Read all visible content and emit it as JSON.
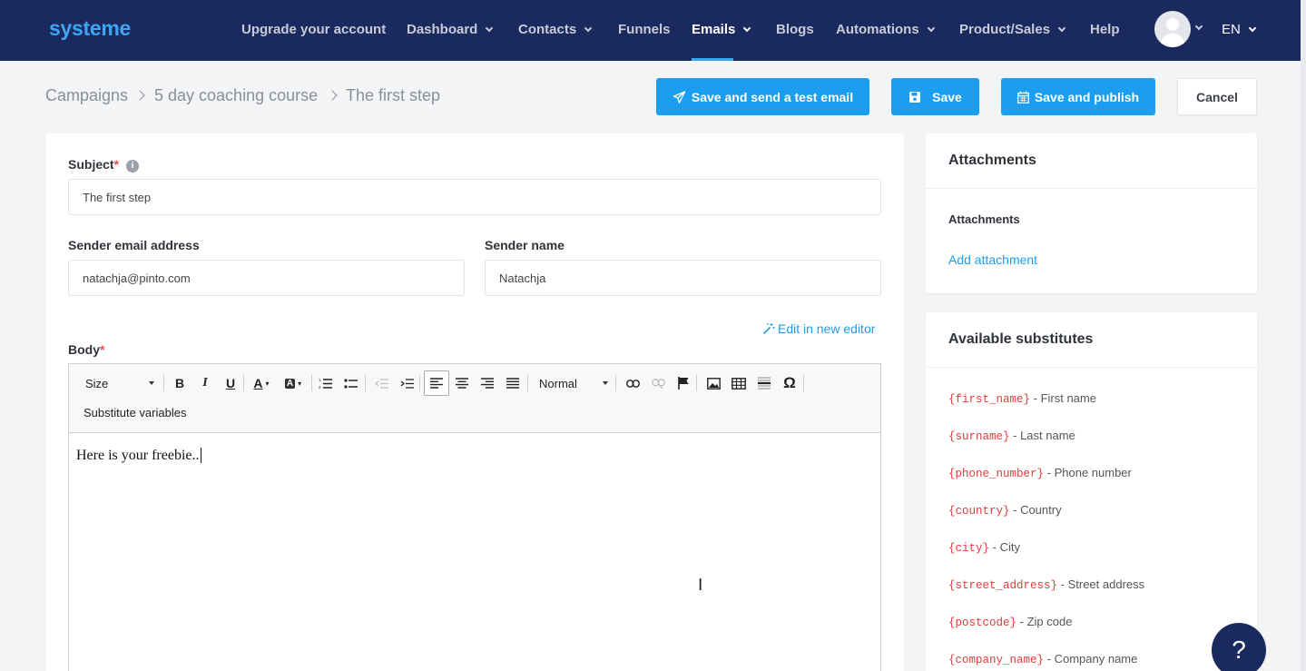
{
  "nav": {
    "logo": "systeme",
    "items": [
      {
        "label": "Upgrade your account"
      },
      {
        "label": "Dashboard"
      },
      {
        "label": "Contacts"
      },
      {
        "label": "Funnels"
      },
      {
        "label": "Emails"
      },
      {
        "label": "Blogs"
      },
      {
        "label": "Automations"
      },
      {
        "label": "Product/Sales"
      },
      {
        "label": "Help"
      }
    ],
    "language": "EN"
  },
  "breadcrumb": [
    "Campaigns",
    "5 day coaching course",
    "The first step"
  ],
  "actions": {
    "send_test": "Save and send a test email",
    "save": "Save",
    "publish": "Save and publish",
    "cancel": "Cancel"
  },
  "form": {
    "subject_label": "Subject",
    "required_mark": "*",
    "subject_value": "The first step",
    "sender_email_label": "Sender email address",
    "sender_email_value": "natachja@pinto.com",
    "sender_name_label": "Sender name",
    "sender_name_value": "Natachja",
    "edit_new_editor": "Edit in new editor",
    "body_label": "Body"
  },
  "editor": {
    "size_label": "Size",
    "format_label": "Normal",
    "substitute_label": "Substitute variables",
    "content": "Here is your freebie..",
    "omega": "Ω"
  },
  "attachments": {
    "title": "Attachments",
    "subtitle": "Attachments",
    "add_link": "Add attachment"
  },
  "substitutes": {
    "title": "Available substitutes",
    "items": [
      {
        "code": "{first_name}",
        "desc": " - First name"
      },
      {
        "code": "{surname}",
        "desc": " - Last name"
      },
      {
        "code": "{phone_number}",
        "desc": " - Phone number"
      },
      {
        "code": "{country}",
        "desc": " - Country"
      },
      {
        "code": "{city}",
        "desc": " - City"
      },
      {
        "code": "{street_address}",
        "desc": " - Street address"
      },
      {
        "code": "{postcode}",
        "desc": " - Zip code"
      },
      {
        "code": "{company_name}",
        "desc": " - Company name"
      }
    ]
  },
  "help_button": "?",
  "colors": {
    "nav_bg": "#1b2a5e",
    "accent": "#1b9ef0",
    "variable_red": "#e13c3c"
  }
}
